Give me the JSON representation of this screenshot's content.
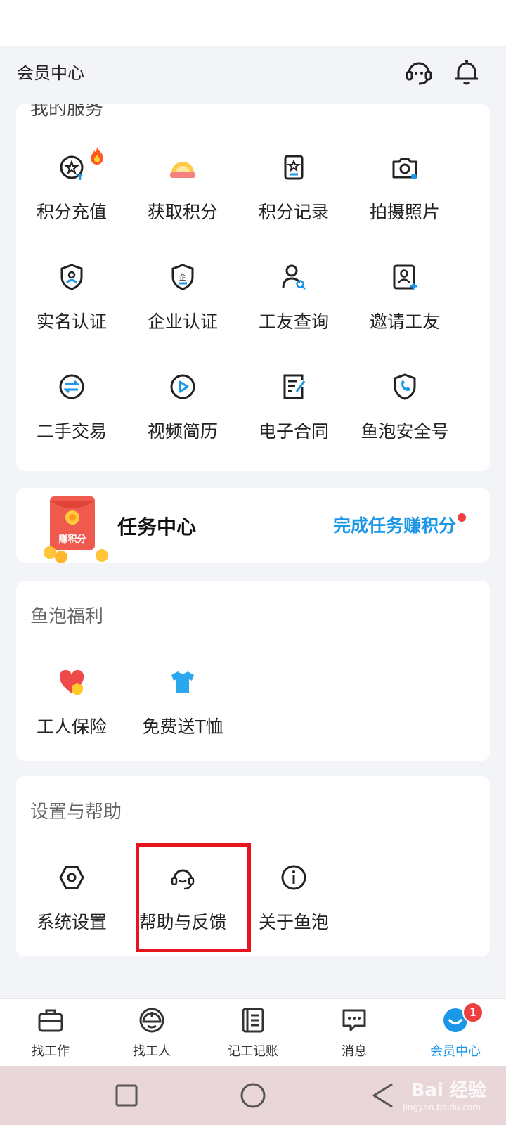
{
  "header": {
    "title": "会员中心",
    "support_icon": "customer-service-icon",
    "bell_icon": "bell-icon"
  },
  "services": {
    "partial_title": "我的服务",
    "items": [
      {
        "label": "积分充值",
        "icon": "points-recharge-icon"
      },
      {
        "label": "获取积分",
        "icon": "get-points-icon"
      },
      {
        "label": "积分记录",
        "icon": "points-record-icon"
      },
      {
        "label": "拍摄照片",
        "icon": "camera-icon"
      },
      {
        "label": "实名认证",
        "icon": "realname-shield-icon"
      },
      {
        "label": "企业认证",
        "icon": "enterprise-shield-icon"
      },
      {
        "label": "工友查询",
        "icon": "worker-search-icon"
      },
      {
        "label": "邀请工友",
        "icon": "invite-worker-icon"
      },
      {
        "label": "二手交易",
        "icon": "exchange-icon"
      },
      {
        "label": "视频简历",
        "icon": "video-play-icon"
      },
      {
        "label": "电子合同",
        "icon": "contract-icon"
      },
      {
        "label": "鱼泡安全号",
        "icon": "secure-phone-icon"
      }
    ]
  },
  "task": {
    "title": "任务中心",
    "link": "完成任务赚积分",
    "badge_text": "赚积分"
  },
  "welfare": {
    "title": "鱼泡福利",
    "items": [
      {
        "label": "工人保险",
        "icon": "insurance-heart-icon"
      },
      {
        "label": "免费送T恤",
        "icon": "tshirt-icon"
      }
    ]
  },
  "settings": {
    "title": "设置与帮助",
    "items": [
      {
        "label": "系统设置",
        "icon": "settings-hex-icon"
      },
      {
        "label": "帮助与反馈",
        "icon": "headset-icon"
      },
      {
        "label": "关于鱼泡",
        "icon": "info-icon"
      }
    ]
  },
  "tabbar": {
    "items": [
      {
        "label": "找工作",
        "icon": "briefcase-icon"
      },
      {
        "label": "找工人",
        "icon": "helmet-icon"
      },
      {
        "label": "记工记账",
        "icon": "ledger-icon"
      },
      {
        "label": "消息",
        "icon": "message-icon"
      },
      {
        "label": "会员中心",
        "icon": "member-smile-icon"
      }
    ],
    "active_index": 4,
    "badge_count": "1"
  },
  "watermark": {
    "text": "Bai 经验",
    "sub": "jingyan.baidu.com"
  },
  "colors": {
    "accent": "#1a97e8",
    "highlight": "#e5141d",
    "badge": "#ee3f3f"
  }
}
